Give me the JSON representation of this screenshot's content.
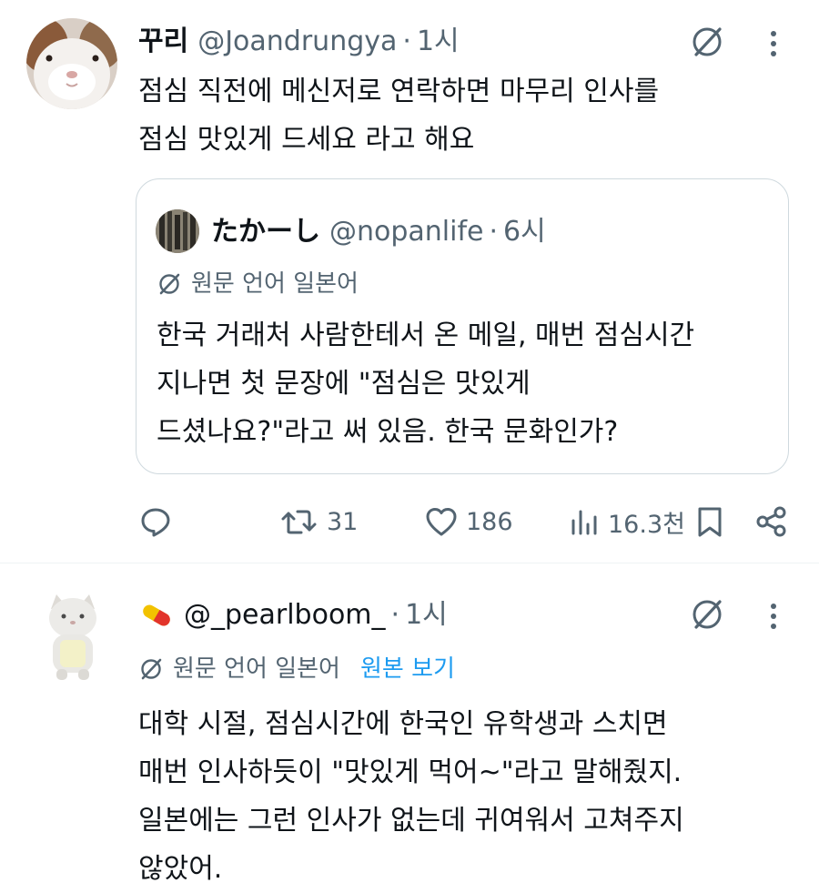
{
  "tweet1": {
    "display_name": "꾸리",
    "handle": "@Joandrungya",
    "separator": "·",
    "time": "1시",
    "body_lines": [
      "점심 직전에 메신저로 연락하면 마무리 인사를",
      "점심 맛있게 드세요 라고 해요"
    ],
    "quote": {
      "display_name": "たかーし",
      "handle": "@nopanlife",
      "separator": "·",
      "time": "6시",
      "translation_note": "원문 언어 일본어",
      "body_lines": [
        "한국 거래처 사람한테서 온 메일, 매번 점심시간",
        "지나면 첫 문장에 \"점심은 맛있게",
        "드셨나요?\"라고 써 있음. 한국 문화인가?"
      ]
    },
    "actions": {
      "replies": "",
      "retweets": "31",
      "likes": "186",
      "views": "16.3천"
    }
  },
  "tweet2": {
    "display_name_emoji": "pill-emoji",
    "handle": "@_pearlboom_",
    "separator": "·",
    "time": "1시",
    "translation_note": "원문 언어 일본어",
    "show_original": "원본 보기",
    "body_lines": [
      "대학 시절, 점심시간에 한국인 유학생과 스치면",
      "매번 인사하듯이 \"맛있게 먹어~\"라고 말해줬지.",
      "일본에는 그런 인사가 없는데 귀여워서 고쳐주지",
      "않았어."
    ]
  },
  "colors": {
    "text_primary": "#0f1419",
    "text_secondary": "#536471",
    "link_blue": "#1d9bf0",
    "border": "#cfd9de"
  },
  "icons": {
    "grok": "grok-slash-icon",
    "more": "more-vertical-icon",
    "reply": "reply-icon",
    "retweet": "retweet-icon",
    "like": "heart-icon",
    "views": "views-icon",
    "bookmark": "bookmark-icon",
    "share": "share-icon"
  }
}
